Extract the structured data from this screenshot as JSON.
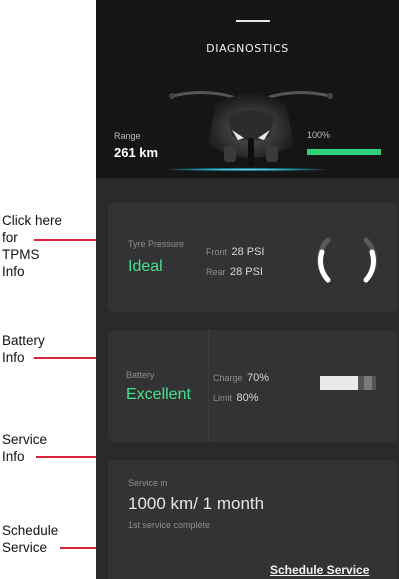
{
  "annotations": {
    "tpms": [
      "Click here",
      "for",
      "TPMS",
      "Info"
    ],
    "battery": [
      "Battery",
      "Info"
    ],
    "service": [
      "Service",
      "Info"
    ],
    "schedule": [
      "Schedule",
      "Service"
    ]
  },
  "header": {
    "title": "DIAGNOSTICS"
  },
  "hero": {
    "range_label": "Range",
    "range_value": "261 km",
    "battery_percent_label": "100%",
    "battery_level": 1.0
  },
  "tyre": {
    "label": "Tyre Pressure",
    "status": "Ideal",
    "front_label": "Front",
    "front_value": "28 PSI",
    "rear_label": "Rear",
    "rear_value": "28 PSI"
  },
  "battery": {
    "label": "Battery",
    "status": "Excellent",
    "charge_label": "Charge",
    "charge_value": "70%",
    "limit_label": "Limit",
    "limit_value": "80%"
  },
  "service": {
    "label": "Service in",
    "value": "1000 km/ 1 month",
    "note": "1st service complete",
    "schedule_link": "Schedule Service"
  },
  "colors": {
    "accent": "#45e38e",
    "callout": "#d9223c",
    "panel": "#2a2a2c",
    "card": "#333335"
  }
}
